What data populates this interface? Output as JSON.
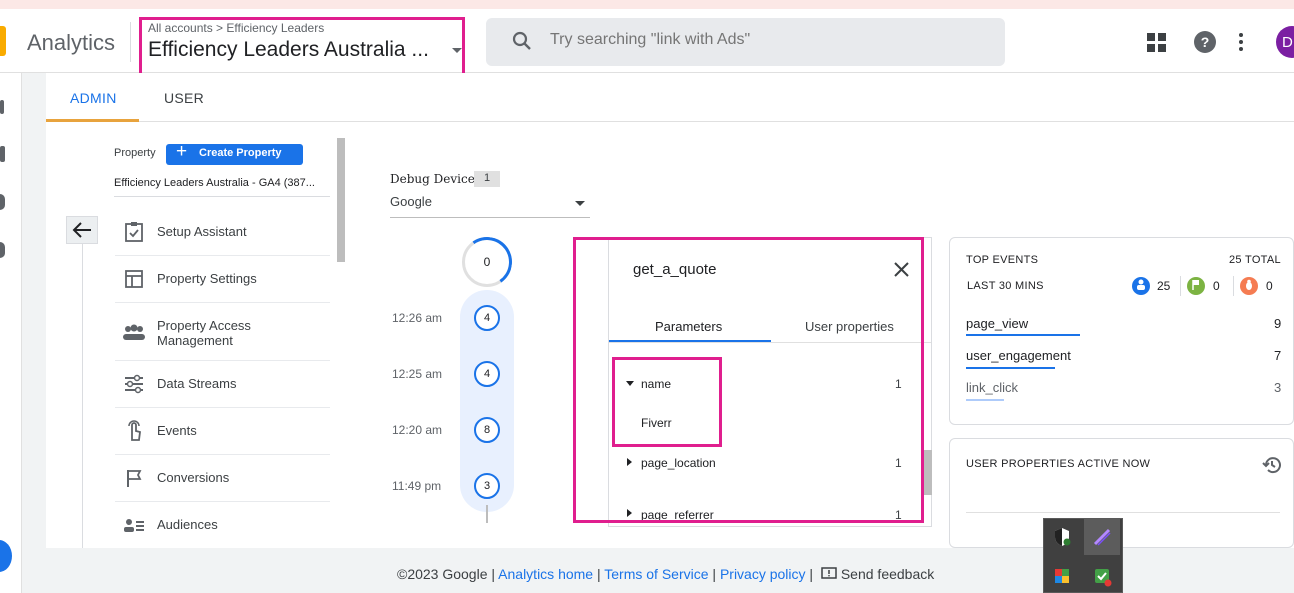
{
  "header": {
    "app_name": "Analytics",
    "breadcrumb": "All accounts > Efficiency Leaders",
    "account_title": "Efficiency Leaders Australia ...",
    "search_placeholder": "Try searching \"link with Ads\"",
    "avatar_initial": "D"
  },
  "tabs": {
    "admin": "ADMIN",
    "user": "USER"
  },
  "sidebar": {
    "property_label": "Property",
    "create_button": "Create Property",
    "property_name": "Efficiency Leaders Australia - GA4 (387...",
    "items": [
      {
        "label": "Setup Assistant",
        "icon": "checklist-icon"
      },
      {
        "label": "Property Settings",
        "icon": "window-icon"
      },
      {
        "label": "Property Access Management",
        "icon": "people-icon"
      },
      {
        "label": "Data Streams",
        "icon": "streams-icon"
      },
      {
        "label": "Events",
        "icon": "touch-icon"
      },
      {
        "label": "Conversions",
        "icon": "flag-icon"
      },
      {
        "label": "Audiences",
        "icon": "audience-icon"
      }
    ]
  },
  "debug": {
    "label": "Debug Device",
    "count": "1",
    "device": "Google",
    "top_count": "0",
    "timeline": [
      {
        "time": "12:26 am",
        "count": "4"
      },
      {
        "time": "12:25 am",
        "count": "4"
      },
      {
        "time": "12:20 am",
        "count": "8"
      },
      {
        "time": "11:49 pm",
        "count": "3"
      }
    ]
  },
  "event": {
    "name": "get_a_quote",
    "tab_parameters": "Parameters",
    "tab_user_properties": "User properties",
    "params": [
      {
        "name": "name",
        "count": "1",
        "value": "Fiverr",
        "expanded": true
      },
      {
        "name": "page_location",
        "count": "1"
      },
      {
        "name": "page_referrer",
        "count": "1"
      }
    ]
  },
  "top_events": {
    "title": "TOP EVENTS",
    "total": "25 TOTAL",
    "period": "LAST 30 MINS",
    "stats": [
      {
        "icon": "user-icon",
        "value": "25",
        "color": "#1a73e8"
      },
      {
        "icon": "flag-icon",
        "value": "0",
        "color": "#7cb342"
      },
      {
        "icon": "bug-icon",
        "value": "0",
        "color": "#f57c52"
      }
    ],
    "rows": [
      {
        "name": "page_view",
        "count": "9"
      },
      {
        "name": "user_engagement",
        "count": "7"
      },
      {
        "name": "link_click",
        "count": "3"
      }
    ]
  },
  "user_properties": {
    "title": "USER PROPERTIES ACTIVE NOW"
  },
  "footer": {
    "copyright": "©2023 Google",
    "analytics_home": "Analytics home",
    "terms": "Terms of Service",
    "privacy": "Privacy policy",
    "feedback": "Send feedback",
    "sep": "|"
  },
  "colors": {
    "accent": "#1a73e8",
    "highlight": "#e01e8e",
    "admin_underline": "#e8a33d"
  }
}
